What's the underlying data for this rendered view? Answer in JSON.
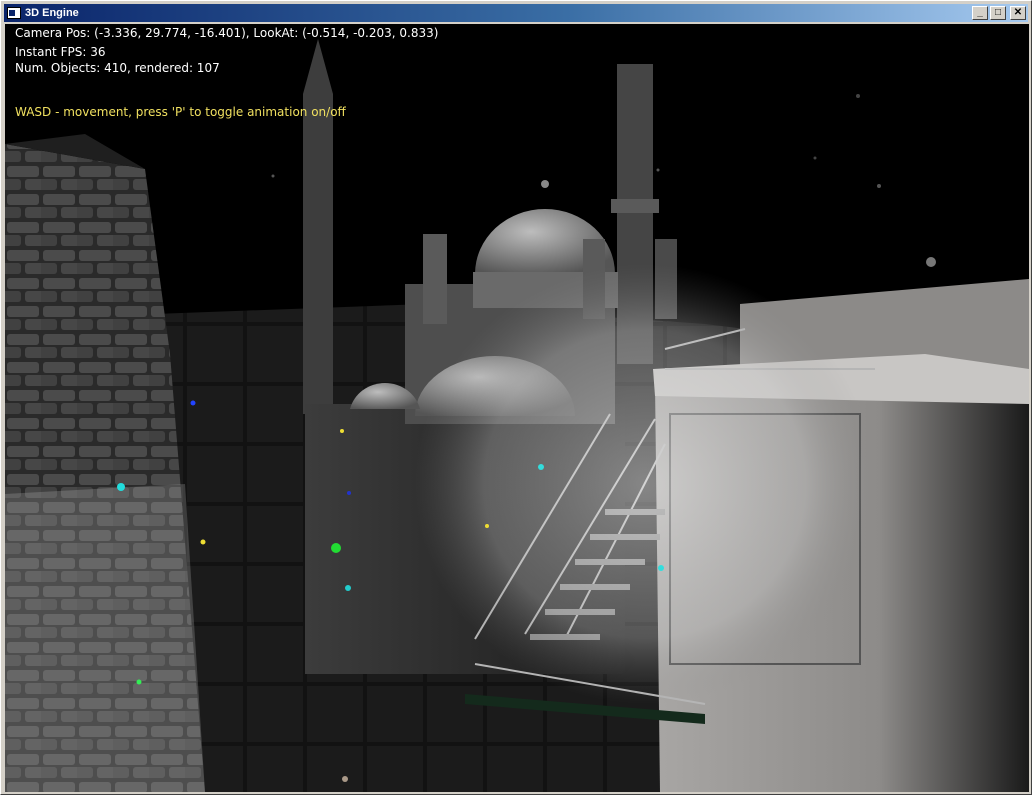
{
  "window": {
    "title": "3D Engine",
    "minimize_glyph": "_",
    "maximize_glyph": "□",
    "close_glyph": "✕"
  },
  "hud": {
    "camera_line": "Camera Pos: (-3.336, 29.774, -16.401), LookAt: (-0.514, -0.203, 0.833)",
    "fps_line": "Instant FPS: 36",
    "objects_line": "Num. Objects: 410, rendered: 107",
    "help_line": "WASD - movement, press 'P' to toggle animation on/off"
  },
  "colors": {
    "hud_text": "#ffffff",
    "help_text": "#f0e060",
    "titlebar_start": "#0a246a",
    "titlebar_end": "#a6caf0"
  }
}
